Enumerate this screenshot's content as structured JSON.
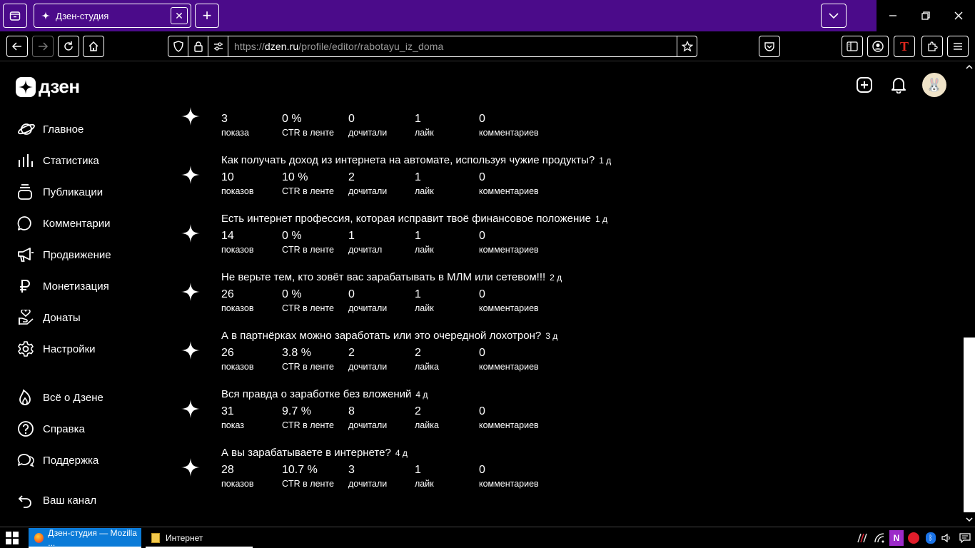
{
  "browser": {
    "tab_title": "Дзен-студия",
    "url_host": "dzen.ru",
    "url_prefix": "https://",
    "url_path": "/profile/editor/rabotayu_iz_doma"
  },
  "header": {
    "logo_text": "дзен"
  },
  "sidebar": {
    "items": [
      {
        "label": "Главное",
        "icon": "planet-icon"
      },
      {
        "label": "Статистика",
        "icon": "bar-chart-icon"
      },
      {
        "label": "Публикации",
        "icon": "stack-icon"
      },
      {
        "label": "Комментарии",
        "icon": "speech-bubble-icon"
      },
      {
        "label": "Продвижение",
        "icon": "megaphone-icon"
      },
      {
        "label": "Монетизация",
        "icon": "ruble-icon"
      },
      {
        "label": "Донаты",
        "icon": "hand-heart-icon"
      },
      {
        "label": "Настройки",
        "icon": "gear-icon"
      },
      {
        "label": "Всё о Дзене",
        "icon": "flame-icon"
      },
      {
        "label": "Справка",
        "icon": "question-icon"
      },
      {
        "label": "Поддержка",
        "icon": "chat-icon"
      },
      {
        "label": "Ваш канал",
        "icon": "back-arrow-icon"
      }
    ]
  },
  "publications": [
    {
      "title": "",
      "age": "",
      "stats": [
        {
          "v": "3",
          "l": "показа"
        },
        {
          "v": "0 %",
          "l": "CTR в ленте"
        },
        {
          "v": "0",
          "l": "дочитали"
        },
        {
          "v": "1",
          "l": "лайк"
        },
        {
          "v": "0",
          "l": "комментариев"
        }
      ]
    },
    {
      "title": "Как получать доход из интернета на автомате, используя чужие продукты?",
      "age": "1 д",
      "stats": [
        {
          "v": "10",
          "l": "показов"
        },
        {
          "v": "10 %",
          "l": "CTR в ленте"
        },
        {
          "v": "2",
          "l": "дочитали"
        },
        {
          "v": "1",
          "l": "лайк"
        },
        {
          "v": "0",
          "l": "комментариев"
        }
      ]
    },
    {
      "title": "Есть интернет профессия, которая исправит твоё финансовое положение",
      "age": "1 д",
      "stats": [
        {
          "v": "14",
          "l": "показов"
        },
        {
          "v": "0 %",
          "l": "CTR в ленте"
        },
        {
          "v": "1",
          "l": "дочитал"
        },
        {
          "v": "1",
          "l": "лайк"
        },
        {
          "v": "0",
          "l": "комментариев"
        }
      ]
    },
    {
      "title": "Не верьте тем, кто зовёт вас зарабатывать в МЛМ или сетевом!!!",
      "age": "2 д",
      "stats": [
        {
          "v": "26",
          "l": "показов"
        },
        {
          "v": "0 %",
          "l": "CTR в ленте"
        },
        {
          "v": "0",
          "l": "дочитали"
        },
        {
          "v": "1",
          "l": "лайк"
        },
        {
          "v": "0",
          "l": "комментариев"
        }
      ]
    },
    {
      "title": "А в партнёрках можно заработать или это очередной лохотрон?",
      "age": "3 д",
      "stats": [
        {
          "v": "26",
          "l": "показов"
        },
        {
          "v": "3.8 %",
          "l": "CTR в ленте"
        },
        {
          "v": "2",
          "l": "дочитали"
        },
        {
          "v": "2",
          "l": "лайка"
        },
        {
          "v": "0",
          "l": "комментариев"
        }
      ]
    },
    {
      "title": "Вся правда о заработке без вложений",
      "age": "4 д",
      "stats": [
        {
          "v": "31",
          "l": "показ"
        },
        {
          "v": "9.7 %",
          "l": "CTR в ленте"
        },
        {
          "v": "8",
          "l": "дочитали"
        },
        {
          "v": "2",
          "l": "лайка"
        },
        {
          "v": "0",
          "l": "комментариев"
        }
      ]
    },
    {
      "title": "А вы зарабатываете в интернете?",
      "age": "4 д",
      "stats": [
        {
          "v": "28",
          "l": "показов"
        },
        {
          "v": "10.7 %",
          "l": "CTR в ленте"
        },
        {
          "v": "3",
          "l": "дочитали"
        },
        {
          "v": "1",
          "l": "лайк"
        },
        {
          "v": "0",
          "l": "комментариев"
        }
      ]
    }
  ],
  "taskbar": {
    "firefox_label": "Дзен-студия — Mozilla ...",
    "folder_label": "Интернет"
  }
}
